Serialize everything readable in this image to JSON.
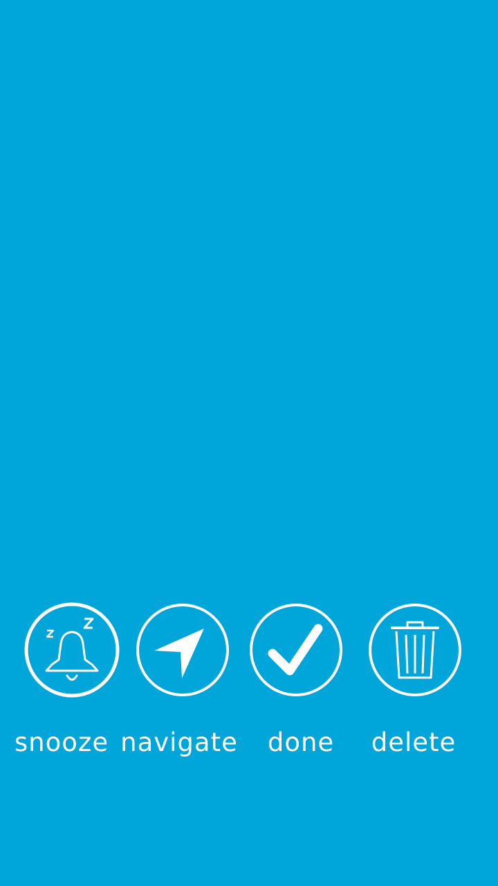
{
  "screen": {
    "background_color": "#00A6DA",
    "foreground_color": "#FFFFFF"
  },
  "actions": [
    {
      "label": "snooze",
      "icon": "bell-snooze-icon"
    },
    {
      "label": "navigate",
      "icon": "navigation-arrow-icon"
    },
    {
      "label": "done",
      "icon": "checkmark-icon"
    },
    {
      "label": "delete",
      "icon": "trash-icon"
    }
  ]
}
